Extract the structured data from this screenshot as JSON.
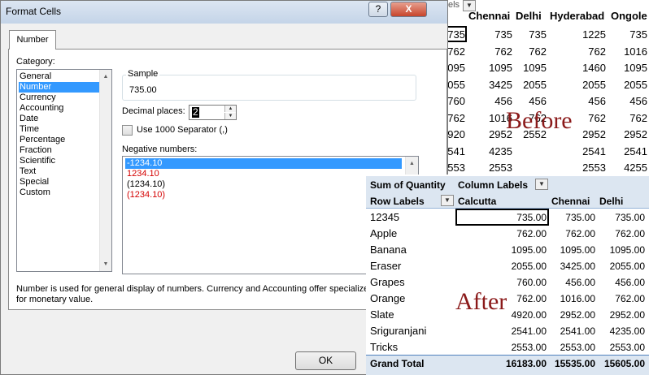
{
  "before": {
    "top_strip": "els",
    "headers": [
      "Chennai",
      "Delhi",
      "Hyderabad",
      "Ongole"
    ],
    "col_a": [
      "735",
      "762",
      "1095",
      "2055",
      "760",
      "762",
      "4920",
      "2541",
      "2553"
    ],
    "rows": [
      [
        "735",
        "735",
        "1225",
        "735"
      ],
      [
        "762",
        "762",
        "762",
        "1016"
      ],
      [
        "1095",
        "1095",
        "1460",
        "1095"
      ],
      [
        "3425",
        "2055",
        "2055",
        "2055"
      ],
      [
        "456",
        "456",
        "456",
        "456"
      ],
      [
        "1016",
        "762",
        "762",
        "762"
      ],
      [
        "2952",
        "2552",
        "2952",
        "2952"
      ],
      [
        "4235",
        "",
        "2541",
        "2541"
      ],
      [
        "2553",
        "",
        "2553",
        "4255"
      ]
    ],
    "label": "Before"
  },
  "dialog": {
    "title": "Format Cells",
    "help": "?",
    "close": "X",
    "tab": "Number",
    "category_label": "Category:",
    "categories": [
      "General",
      "Number",
      "Currency",
      "Accounting",
      "Date",
      "Time",
      "Percentage",
      "Fraction",
      "Scientific",
      "Text",
      "Special",
      "Custom"
    ],
    "selected_category": "Number",
    "sample_label": "Sample",
    "sample_value": "735.00",
    "decimal_label": "Decimal places:",
    "decimal_value": "2",
    "separator_label": "Use 1000 Separator (,)",
    "separator_checked": false,
    "negative_label": "Negative numbers:",
    "negatives": [
      {
        "text": "-1234.10",
        "color": "#ffffff",
        "selected": true
      },
      {
        "text": "1234.10",
        "color": "#d40000",
        "selected": false
      },
      {
        "text": "(1234.10)",
        "color": "#000000",
        "selected": false
      },
      {
        "text": "(1234.10)",
        "color": "#d40000",
        "selected": false
      }
    ],
    "description_line1": "Number is used for general display of numbers.  Currency and Accounting offer specialize",
    "description_line2": "for monetary value.",
    "ok": "OK"
  },
  "after": {
    "sum_label": "Sum of Quantity",
    "column_labels": "Column Labels",
    "row_labels": "Row Labels",
    "columns": [
      "Calcutta",
      "Chennai",
      "Delhi"
    ],
    "rows": [
      {
        "label": "12345",
        "values": [
          "735.00",
          "735.00",
          "735.00"
        ]
      },
      {
        "label": "Apple",
        "values": [
          "762.00",
          "762.00",
          "762.00"
        ]
      },
      {
        "label": "Banana",
        "values": [
          "1095.00",
          "1095.00",
          "1095.00"
        ]
      },
      {
        "label": "Eraser",
        "values": [
          "2055.00",
          "3425.00",
          "2055.00"
        ]
      },
      {
        "label": "Grapes",
        "values": [
          "760.00",
          "456.00",
          "456.00"
        ]
      },
      {
        "label": "Orange",
        "values": [
          "762.00",
          "1016.00",
          "762.00"
        ]
      },
      {
        "label": "Slate",
        "values": [
          "4920.00",
          "2952.00",
          "2952.00"
        ]
      },
      {
        "label": "Sriguranjani",
        "values": [
          "2541.00",
          "2541.00",
          "4235.00"
        ]
      },
      {
        "label": "Tricks",
        "values": [
          "2553.00",
          "2553.00",
          "2553.00"
        ]
      }
    ],
    "total": {
      "label": "Grand Total",
      "values": [
        "16183.00",
        "15535.00",
        "15605.00"
      ]
    },
    "label": "After"
  }
}
